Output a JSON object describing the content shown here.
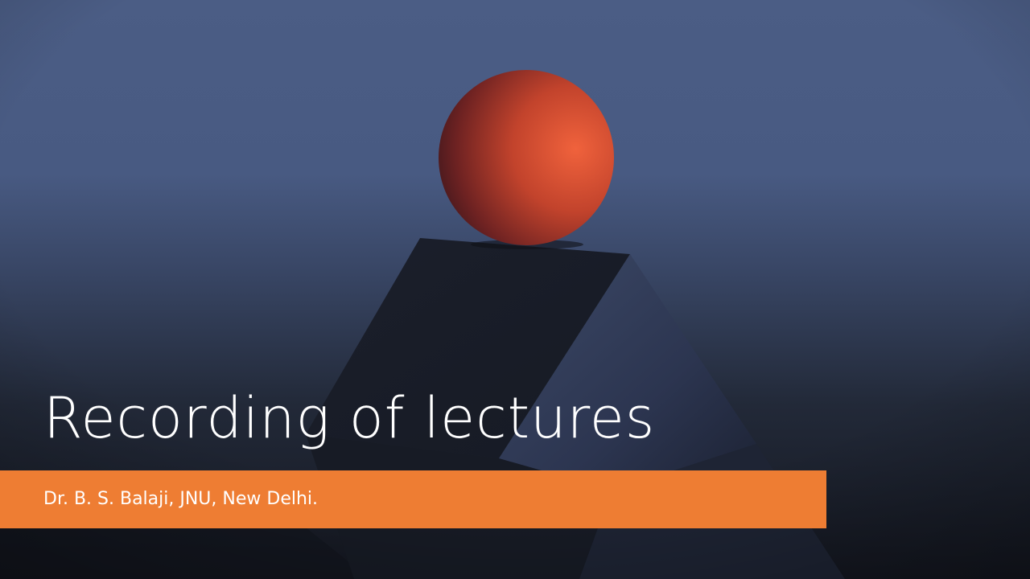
{
  "slide": {
    "title": "Recording of lectures",
    "subtitle": "Dr. B. S. Balaji, JNU, New Delhi."
  },
  "colors": {
    "accent_bar": "#ee7d33",
    "sphere": "#d44a2e",
    "background_top": "#4a5d84",
    "background_bottom": "#151821",
    "text": "#ffffff"
  }
}
